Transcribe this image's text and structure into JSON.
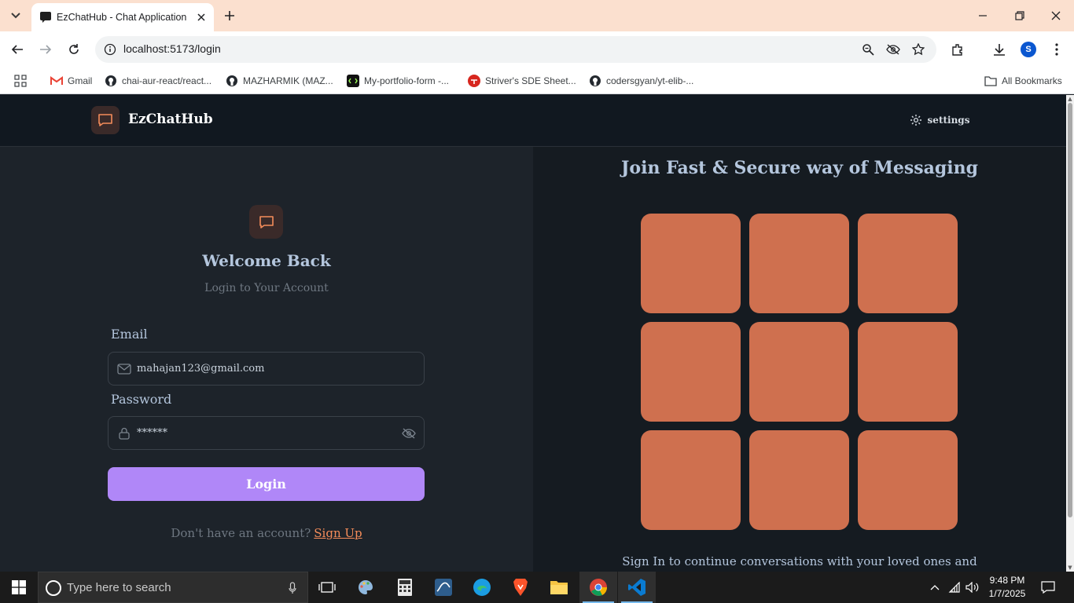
{
  "browser": {
    "tab_title": "EzChatHub - Chat Application",
    "url": "localhost:5173/login",
    "profile_initial": "S",
    "bookmarks": [
      {
        "label": "Gmail",
        "icon": "gmail-icon"
      },
      {
        "label": "chai-aur-react/react...",
        "icon": "github-icon"
      },
      {
        "label": "MAZHARMIK (MAZ...",
        "icon": "github-icon"
      },
      {
        "label": "My-portfolio-form -...",
        "icon": "code-icon"
      },
      {
        "label": "Striver's SDE Sheet...",
        "icon": "tuf-icon"
      },
      {
        "label": "codersgyan/yt-elib-...",
        "icon": "github-icon"
      }
    ],
    "all_bookmarks_label": "All Bookmarks"
  },
  "header": {
    "app_name": "EzChatHub",
    "settings_label": "settings"
  },
  "login": {
    "title": "Welcome Back",
    "subtitle": "Login to Your Account",
    "email_label": "Email",
    "email_value": "mahajan123@gmail.com",
    "password_label": "Password",
    "password_value": "******",
    "login_button": "Login",
    "signup_prompt": "Don't have an account?",
    "signup_link": "Sign Up"
  },
  "promo": {
    "title": "Join Fast & Secure way of Messaging",
    "tiles": 9,
    "text": "Sign In to continue conversations with your loved ones and"
  },
  "taskbar": {
    "search_placeholder": "Type here to search",
    "time": "9:48 PM",
    "date": "1/7/2025"
  },
  "colors": {
    "accent": "#b087f8",
    "tile": "#cf704f",
    "link": "#f48c5a",
    "header_bg": "#111820"
  }
}
